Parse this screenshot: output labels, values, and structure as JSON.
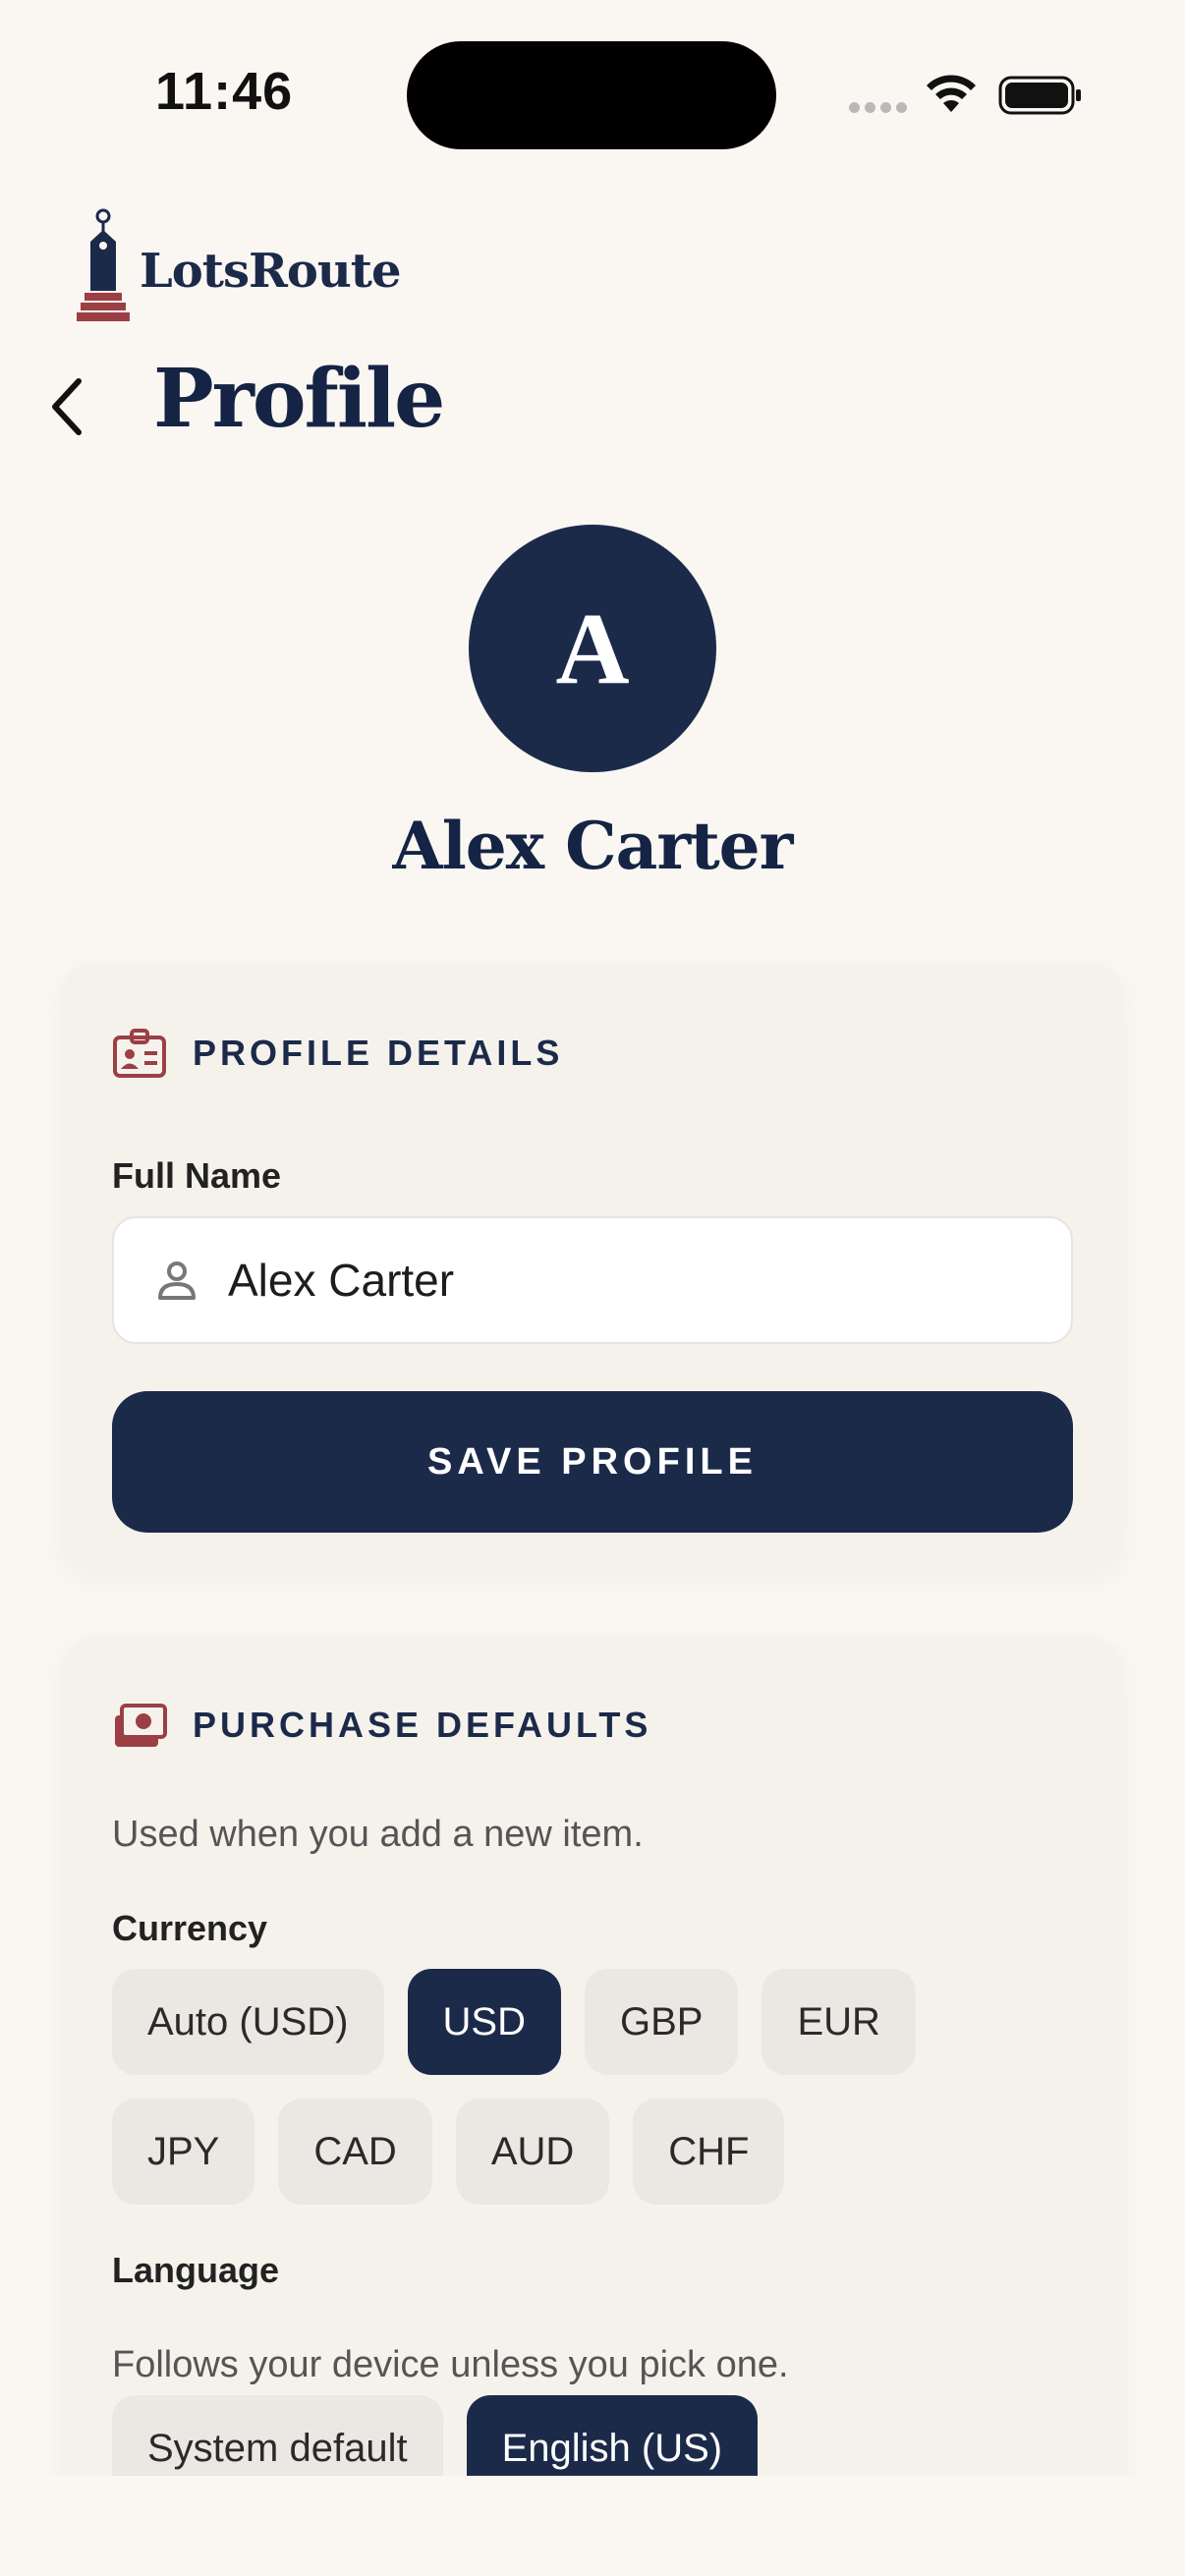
{
  "status_bar": {
    "time": "11:46"
  },
  "brand": {
    "name": "LotsRoute"
  },
  "header": {
    "title": "Profile"
  },
  "profile": {
    "avatar_initial": "A",
    "name": "Alex Carter"
  },
  "profile_details": {
    "section_title": "PROFILE DETAILS",
    "full_name_label": "Full Name",
    "full_name_value": "Alex Carter",
    "save_label": "SAVE PROFILE"
  },
  "purchase_defaults": {
    "section_title": "PURCHASE DEFAULTS",
    "description": "Used when you add a new item.",
    "currency_label": "Currency",
    "currency_options": [
      "Auto (USD)",
      "USD",
      "GBP",
      "EUR",
      "JPY",
      "CAD",
      "AUD",
      "CHF"
    ],
    "currency_selected": "USD",
    "language_label": "Language",
    "language_description": "Follows your device unless you pick one.",
    "language_options": [
      "System default",
      "English (US)"
    ],
    "language_selected": "English (US)"
  },
  "colors": {
    "background": "#faf7f2",
    "card": "#f5f2ec",
    "navy": "#1c2a4a",
    "accent": "#9b3f45",
    "chip": "#ebe8e3"
  },
  "icons": {
    "back": "chevron-left-icon",
    "profile_section": "id-badge-icon",
    "purchase_section": "money-icon",
    "name_field": "person-icon"
  }
}
